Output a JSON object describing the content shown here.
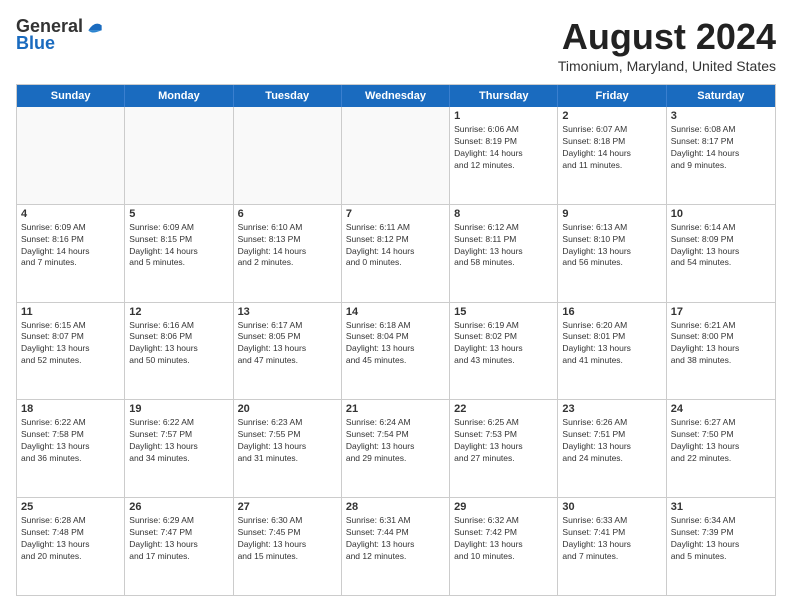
{
  "logo": {
    "general": "General",
    "blue": "Blue"
  },
  "title": "August 2024",
  "subtitle": "Timonium, Maryland, United States",
  "days": [
    "Sunday",
    "Monday",
    "Tuesday",
    "Wednesday",
    "Thursday",
    "Friday",
    "Saturday"
  ],
  "weeks": [
    [
      {
        "day": "",
        "info": ""
      },
      {
        "day": "",
        "info": ""
      },
      {
        "day": "",
        "info": ""
      },
      {
        "day": "",
        "info": ""
      },
      {
        "day": "1",
        "info": "Sunrise: 6:06 AM\nSunset: 8:19 PM\nDaylight: 14 hours\nand 12 minutes."
      },
      {
        "day": "2",
        "info": "Sunrise: 6:07 AM\nSunset: 8:18 PM\nDaylight: 14 hours\nand 11 minutes."
      },
      {
        "day": "3",
        "info": "Sunrise: 6:08 AM\nSunset: 8:17 PM\nDaylight: 14 hours\nand 9 minutes."
      }
    ],
    [
      {
        "day": "4",
        "info": "Sunrise: 6:09 AM\nSunset: 8:16 PM\nDaylight: 14 hours\nand 7 minutes."
      },
      {
        "day": "5",
        "info": "Sunrise: 6:09 AM\nSunset: 8:15 PM\nDaylight: 14 hours\nand 5 minutes."
      },
      {
        "day": "6",
        "info": "Sunrise: 6:10 AM\nSunset: 8:13 PM\nDaylight: 14 hours\nand 2 minutes."
      },
      {
        "day": "7",
        "info": "Sunrise: 6:11 AM\nSunset: 8:12 PM\nDaylight: 14 hours\nand 0 minutes."
      },
      {
        "day": "8",
        "info": "Sunrise: 6:12 AM\nSunset: 8:11 PM\nDaylight: 13 hours\nand 58 minutes."
      },
      {
        "day": "9",
        "info": "Sunrise: 6:13 AM\nSunset: 8:10 PM\nDaylight: 13 hours\nand 56 minutes."
      },
      {
        "day": "10",
        "info": "Sunrise: 6:14 AM\nSunset: 8:09 PM\nDaylight: 13 hours\nand 54 minutes."
      }
    ],
    [
      {
        "day": "11",
        "info": "Sunrise: 6:15 AM\nSunset: 8:07 PM\nDaylight: 13 hours\nand 52 minutes."
      },
      {
        "day": "12",
        "info": "Sunrise: 6:16 AM\nSunset: 8:06 PM\nDaylight: 13 hours\nand 50 minutes."
      },
      {
        "day": "13",
        "info": "Sunrise: 6:17 AM\nSunset: 8:05 PM\nDaylight: 13 hours\nand 47 minutes."
      },
      {
        "day": "14",
        "info": "Sunrise: 6:18 AM\nSunset: 8:04 PM\nDaylight: 13 hours\nand 45 minutes."
      },
      {
        "day": "15",
        "info": "Sunrise: 6:19 AM\nSunset: 8:02 PM\nDaylight: 13 hours\nand 43 minutes."
      },
      {
        "day": "16",
        "info": "Sunrise: 6:20 AM\nSunset: 8:01 PM\nDaylight: 13 hours\nand 41 minutes."
      },
      {
        "day": "17",
        "info": "Sunrise: 6:21 AM\nSunset: 8:00 PM\nDaylight: 13 hours\nand 38 minutes."
      }
    ],
    [
      {
        "day": "18",
        "info": "Sunrise: 6:22 AM\nSunset: 7:58 PM\nDaylight: 13 hours\nand 36 minutes."
      },
      {
        "day": "19",
        "info": "Sunrise: 6:22 AM\nSunset: 7:57 PM\nDaylight: 13 hours\nand 34 minutes."
      },
      {
        "day": "20",
        "info": "Sunrise: 6:23 AM\nSunset: 7:55 PM\nDaylight: 13 hours\nand 31 minutes."
      },
      {
        "day": "21",
        "info": "Sunrise: 6:24 AM\nSunset: 7:54 PM\nDaylight: 13 hours\nand 29 minutes."
      },
      {
        "day": "22",
        "info": "Sunrise: 6:25 AM\nSunset: 7:53 PM\nDaylight: 13 hours\nand 27 minutes."
      },
      {
        "day": "23",
        "info": "Sunrise: 6:26 AM\nSunset: 7:51 PM\nDaylight: 13 hours\nand 24 minutes."
      },
      {
        "day": "24",
        "info": "Sunrise: 6:27 AM\nSunset: 7:50 PM\nDaylight: 13 hours\nand 22 minutes."
      }
    ],
    [
      {
        "day": "25",
        "info": "Sunrise: 6:28 AM\nSunset: 7:48 PM\nDaylight: 13 hours\nand 20 minutes."
      },
      {
        "day": "26",
        "info": "Sunrise: 6:29 AM\nSunset: 7:47 PM\nDaylight: 13 hours\nand 17 minutes."
      },
      {
        "day": "27",
        "info": "Sunrise: 6:30 AM\nSunset: 7:45 PM\nDaylight: 13 hours\nand 15 minutes."
      },
      {
        "day": "28",
        "info": "Sunrise: 6:31 AM\nSunset: 7:44 PM\nDaylight: 13 hours\nand 12 minutes."
      },
      {
        "day": "29",
        "info": "Sunrise: 6:32 AM\nSunset: 7:42 PM\nDaylight: 13 hours\nand 10 minutes."
      },
      {
        "day": "30",
        "info": "Sunrise: 6:33 AM\nSunset: 7:41 PM\nDaylight: 13 hours\nand 7 minutes."
      },
      {
        "day": "31",
        "info": "Sunrise: 6:34 AM\nSunset: 7:39 PM\nDaylight: 13 hours\nand 5 minutes."
      }
    ]
  ]
}
